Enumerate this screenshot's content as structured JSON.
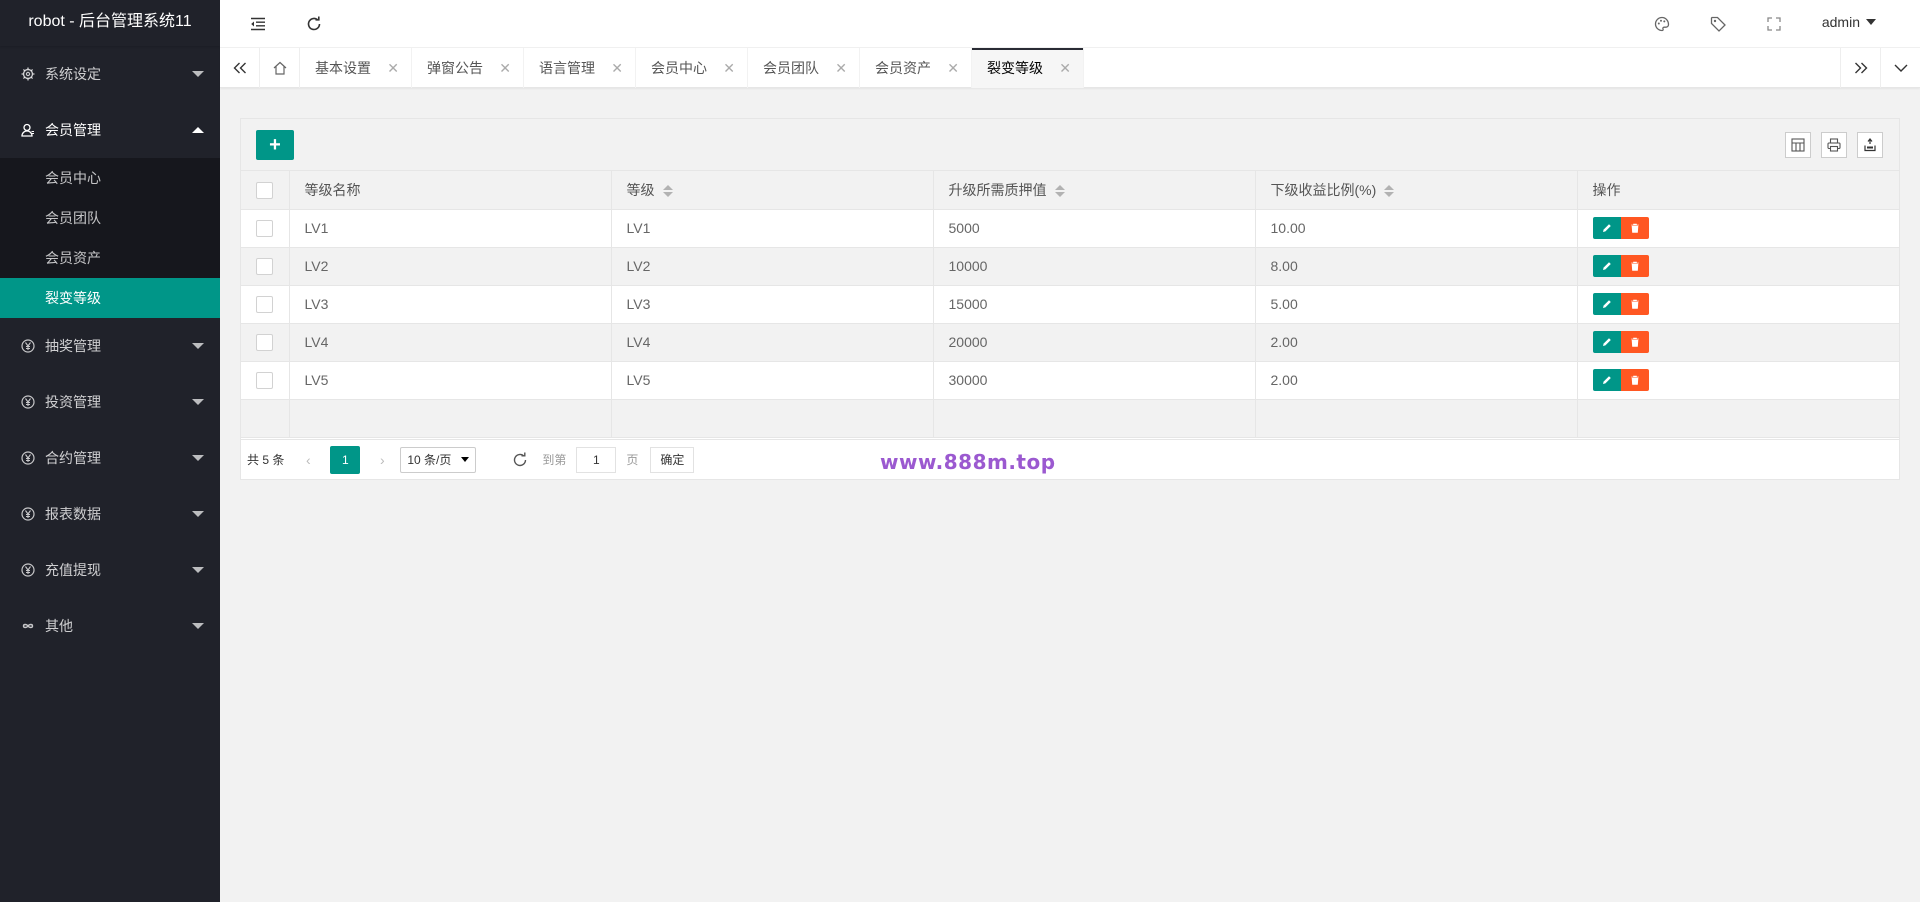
{
  "app_title": "robot - 后台管理系统11",
  "sidebar": {
    "items": [
      {
        "label": "系统设定",
        "icon": "gear-icon",
        "open": false
      },
      {
        "label": "会员管理",
        "icon": "user-icon",
        "open": true,
        "children": [
          "会员中心",
          "会员团队",
          "会员资产",
          "裂变等级"
        ],
        "active_child": "裂变等级"
      },
      {
        "label": "抽奖管理",
        "icon": "yen-icon",
        "open": false
      },
      {
        "label": "投资管理",
        "icon": "yen-icon",
        "open": false
      },
      {
        "label": "合约管理",
        "icon": "yen-icon",
        "open": false
      },
      {
        "label": "报表数据",
        "icon": "yen-icon",
        "open": false
      },
      {
        "label": "充值提现",
        "icon": "yen-icon",
        "open": false
      },
      {
        "label": "其他",
        "icon": "infinity-icon",
        "open": false
      }
    ]
  },
  "header": {
    "user": "admin",
    "icons": [
      "menu-collapse-icon",
      "refresh-icon",
      "palette-icon",
      "tag-icon",
      "fullscreen-icon"
    ]
  },
  "tabs": {
    "items": [
      "基本设置",
      "弹窗公告",
      "语言管理",
      "会员中心",
      "会员团队",
      "会员资产",
      "裂变等级"
    ],
    "active": "裂变等级"
  },
  "table": {
    "columns": [
      "等级名称",
      "等级",
      "升级所需质押值",
      "下级收益比例(%)",
      "操作"
    ],
    "sortable": [
      false,
      true,
      true,
      true,
      false
    ],
    "rows": [
      {
        "name": "LV1",
        "level": "LV1",
        "pledge": "5000",
        "ratio": "10.00"
      },
      {
        "name": "LV2",
        "level": "LV2",
        "pledge": "10000",
        "ratio": "8.00"
      },
      {
        "name": "LV3",
        "level": "LV3",
        "pledge": "15000",
        "ratio": "5.00"
      },
      {
        "name": "LV4",
        "level": "LV4",
        "pledge": "20000",
        "ratio": "2.00"
      },
      {
        "name": "LV5",
        "level": "LV5",
        "pledge": "30000",
        "ratio": "2.00"
      }
    ]
  },
  "pager": {
    "total": "共 5 条",
    "current_page": "1",
    "page_size": "10 条/页",
    "goto_label": "到第",
    "goto_value": "1",
    "unit": "页",
    "confirm": "确定"
  },
  "watermark": "www.888m.top",
  "colors": {
    "accent": "#009688",
    "danger": "#ff5722",
    "sidebar_bg": "#20222a"
  }
}
